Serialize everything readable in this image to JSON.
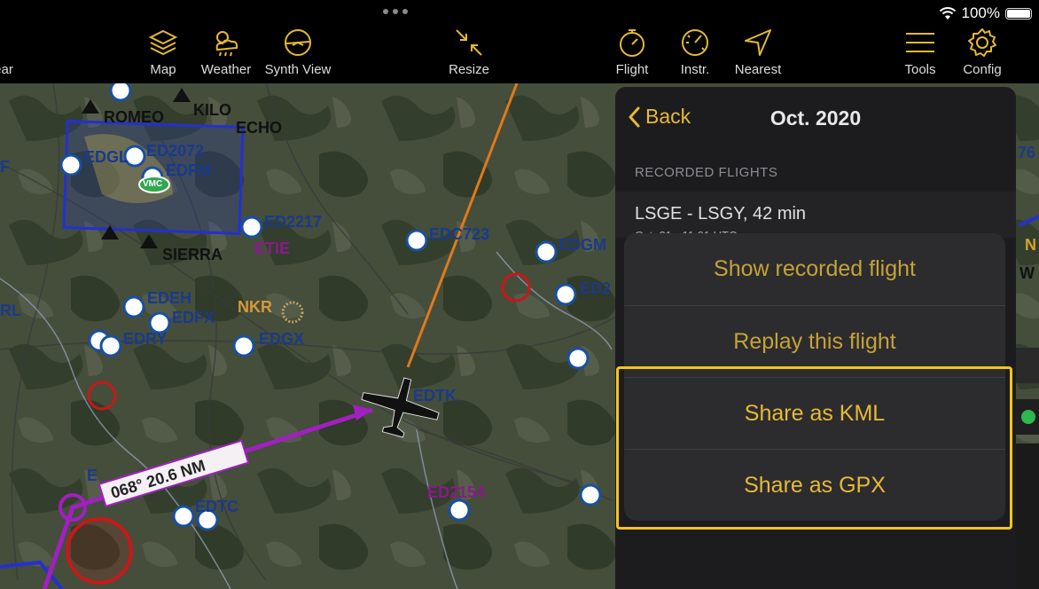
{
  "status": {
    "battery": "100%"
  },
  "toolbar": {
    "items": [
      {
        "label": "ear",
        "icon": "gear-partial-icon"
      },
      {
        "label": "Map",
        "icon": "layers-icon"
      },
      {
        "label": "Weather",
        "icon": "weather-icon"
      },
      {
        "label": "Synth View",
        "icon": "attitude-indicator-icon"
      },
      {
        "label": "Resize",
        "icon": "resize-arrows-icon"
      },
      {
        "label": "Flight",
        "icon": "stopwatch-icon"
      },
      {
        "label": "Instr.",
        "icon": "gauge-icon"
      },
      {
        "label": "Nearest",
        "icon": "navigation-arrow-icon"
      },
      {
        "label": "Tools",
        "icon": "menu-lines-icon"
      },
      {
        "label": "Config",
        "icon": "gear-icon"
      }
    ]
  },
  "map": {
    "labels": {
      "romeo": "ROMEO",
      "kilo": "KILO",
      "echo": "ECHO",
      "sierra": "SIERRA",
      "ed2072": "ED2072",
      "edgl": "EDGL",
      "edfm": "EDFM",
      "vmc": "VMC",
      "ed2217": "ED2217",
      "etie": "ETIE",
      "edc723": "EDC723",
      "edgm": "EDGM",
      "ed2": "ED2",
      "edeh": "EDEH",
      "edfx": "EDFX",
      "nkr": "NKR",
      "edry": "EDRY",
      "edgx": "EDGX",
      "edtk": "EDTK",
      "ed2154": "ED2154",
      "edtc": "EDTC",
      "rl": "RL",
      "f": "F",
      "e": "E",
      "n76": "76",
      "n": "N",
      "w": "W"
    },
    "route_label": "068° 20.6 NM"
  },
  "panel": {
    "back_label": "Back",
    "title": "Oct. 2020",
    "section_header": "RECORDED FLIGHTS",
    "flight": {
      "title": "LSGE - LSGY, 42 min",
      "subtitle": "Oct. 21 - 11:01 UTC"
    }
  },
  "sheet": {
    "show": "Show recorded flight",
    "replay": "Replay this flight",
    "kml": "Share as KML",
    "gpx": "Share as GPX"
  },
  "colors": {
    "accent": "#e6b936",
    "highlight": "#f5c518",
    "route": "#a020c0",
    "track": "#e07a1a"
  }
}
